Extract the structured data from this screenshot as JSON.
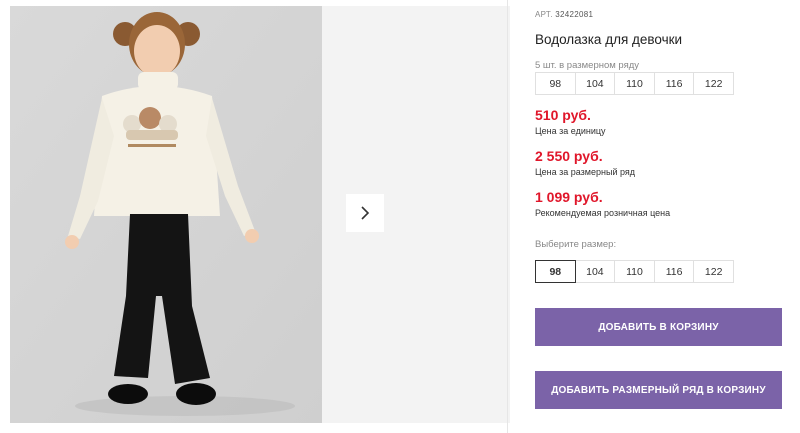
{
  "product": {
    "art_label": "АРТ.",
    "art_number": "32422081",
    "title": "Водолазка для девочки",
    "row_caption": "5 шт. в размерном ряду",
    "row_sizes": [
      "98",
      "104",
      "110",
      "116",
      "122"
    ],
    "prices": [
      {
        "value": "510 руб.",
        "note": "Цена за единицу"
      },
      {
        "value": "2 550 руб.",
        "note": "Цена за размерный ряд"
      },
      {
        "value": "1 099 руб.",
        "note": "Рекомендуемая розничная цена"
      }
    ],
    "select_label": "Выберите размер:",
    "select_sizes": [
      "98",
      "104",
      "110",
      "116",
      "122"
    ],
    "selected_size": "98"
  },
  "actions": {
    "add_to_cart": "ДОБАВИТЬ В КОРЗИНУ",
    "add_row_to_cart": "ДОБАВИТЬ РАЗМЕРНЫЙ РЯД В КОРЗИНУ"
  },
  "colors": {
    "price": "#e0162a",
    "button": "#7b63a8"
  },
  "gallery": {
    "next_icon": "chevron-right-icon"
  }
}
